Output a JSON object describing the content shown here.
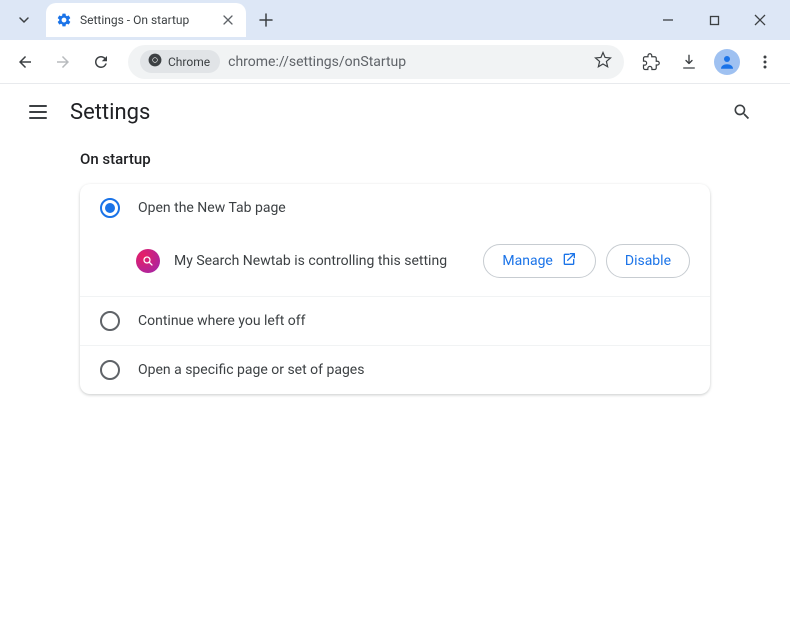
{
  "titlebar": {
    "tab_title": "Settings - On startup"
  },
  "toolbar": {
    "site_chip_label": "Chrome",
    "url": "chrome://settings/onStartup"
  },
  "header": {
    "title": "Settings"
  },
  "section": {
    "title": "On startup"
  },
  "options": {
    "new_tab": "Open the New Tab page",
    "continue": "Continue where you left off",
    "specific": "Open a specific page or set of pages"
  },
  "extension": {
    "message": "My Search Newtab is controlling this setting",
    "manage_label": "Manage",
    "disable_label": "Disable"
  }
}
